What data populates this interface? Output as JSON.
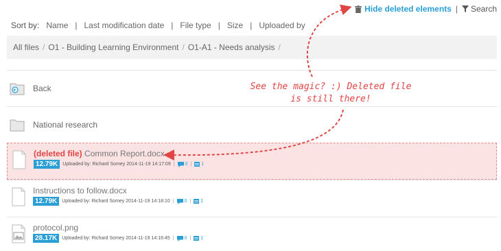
{
  "toolbar": {
    "hide_deleted_label": "Hide deleted elements",
    "separator": "|",
    "search_label": "Search"
  },
  "sortbar": {
    "label": "Sort by:",
    "options": [
      "Name",
      "Last modification date",
      "File type",
      "Size",
      "Uploaded by"
    ],
    "separator": "|"
  },
  "breadcrumb": {
    "items": [
      "All files",
      "O1 - Building Learning Environment",
      "O1-A1 - Needs analysis"
    ],
    "separator": "/"
  },
  "folders": [
    {
      "name": "Back",
      "icon": "back-folder-icon"
    },
    {
      "name": "National research",
      "icon": "folder-icon"
    }
  ],
  "files": [
    {
      "deleted_tag": "(deleted file)",
      "name": "Common Report.docx",
      "size": "12.79K",
      "uploaded": "Uploaded by: Richard Somey 2014-11-19 14:17:09",
      "comments": "0",
      "versions": "1",
      "deleted": true
    },
    {
      "deleted_tag": "",
      "name": "Instructions to follow.docx",
      "size": "12.79K",
      "uploaded": "Uploaded by: Richard Somey 2014-11-19 14:18:10",
      "comments": "0",
      "versions": "1",
      "deleted": false
    },
    {
      "deleted_tag": "",
      "name": "protocol.png",
      "size": "28.17K",
      "uploaded": "Uploaded by: Richard Somey 2014-11-19 14:16:45",
      "comments": "0",
      "versions": "1",
      "deleted": false
    }
  ],
  "annotation": {
    "line1": "See the magic? :) Deleted file",
    "line2": "is still there!"
  },
  "colors": {
    "accent": "#2a9fd6",
    "deleted": "#e04444",
    "deleted_bg": "#fbe3e3"
  }
}
